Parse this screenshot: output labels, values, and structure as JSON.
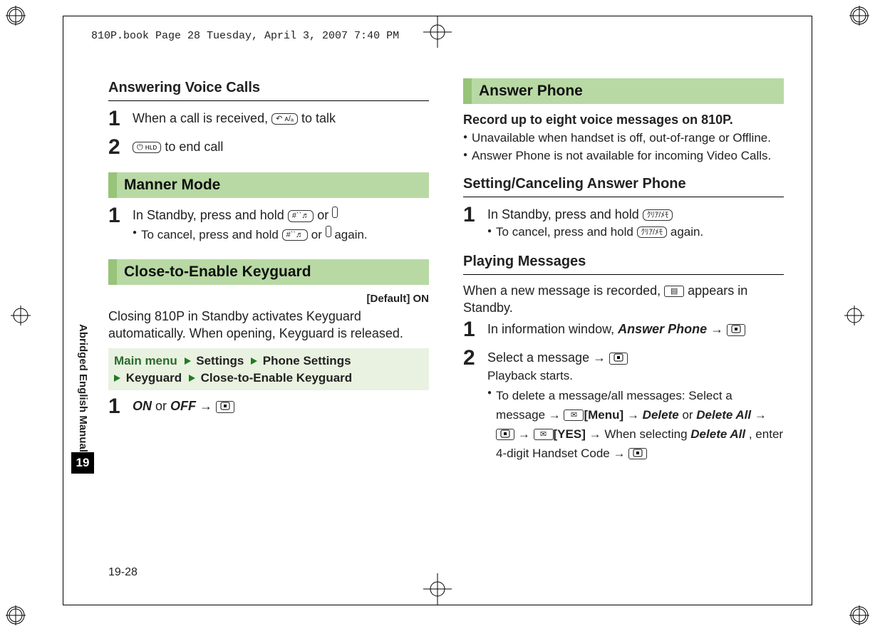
{
  "header": "810P.book  Page 28  Tuesday, April 3, 2007  7:40 PM",
  "side_label": "Abridged English Manual",
  "chapter": "19",
  "page_number": "19-28",
  "left": {
    "h_answering": "Answering Voice Calls",
    "s1": "When a call is received, ",
    "s1b": " to talk",
    "s2": " to end call",
    "sec_manner": "Manner Mode",
    "mm_step": "In Standby, press and hold ",
    "mm_or": " or ",
    "mm_cancel": "To cancel, press and hold ",
    "mm_again": " again.",
    "sec_keyguard": "Close-to-Enable Keyguard",
    "default": "[Default] ON",
    "kg_desc": "Closing 810P in Standby activates Keyguard automatically. When opening, Keyguard is released.",
    "nav_mm": "Main menu",
    "nav1": "Settings",
    "nav2": "Phone Settings",
    "nav3": "Keyguard",
    "nav4": "Close-to-Enable Keyguard",
    "onoff_on": "ON",
    "onoff_or": "  or ",
    "onoff_off": "OFF",
    "arrow": " → "
  },
  "right": {
    "sec_answer": "Answer Phone",
    "intro": "Record up to eight voice messages on 810P.",
    "b1": "Unavailable when handset is off, out-of-range or Offline.",
    "b2": "Answer Phone is not available for incoming Video Calls.",
    "h_setcancel": "Setting/Canceling Answer Phone",
    "sc_step": "In Standby, press and hold ",
    "sc_cancel": "To cancel, press and hold ",
    "sc_again": " again.",
    "h_play": "Playing Messages",
    "play_intro_a": "When a new message is recorded, ",
    "play_intro_b": " appears in Standby.",
    "p1a": "In information window, ",
    "p1b": "Answer Phone",
    "p2a": "Select a message → ",
    "p2b": "Playback starts.",
    "del_a": "To delete a message/all messages: Select a message → ",
    "del_menu": "[Menu]",
    "del_delete": "Delete",
    "del_or": "  or ",
    "del_delall": "Delete All",
    "del_yes": "[YES]",
    "del_b": " → When selecting ",
    "del_c": ", enter 4-digit Handset Code → "
  }
}
